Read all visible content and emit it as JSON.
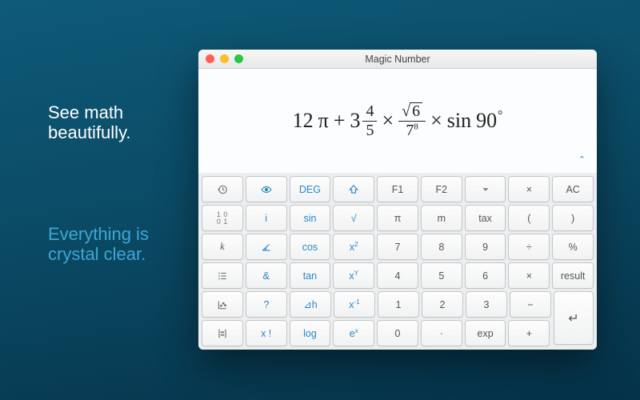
{
  "marketing": {
    "line1": "See math\nbeautifully.",
    "line2": "Everything is\ncrystal clear."
  },
  "window": {
    "title": "Magic Number"
  },
  "expression": {
    "coef": "12",
    "pi": "π",
    "plus": "+",
    "mixed_int": "3",
    "mixed_num": "4",
    "mixed_den": "5",
    "times": "×",
    "sqrt_arg": "6",
    "big_frac_base": "7",
    "big_frac_exp": "8",
    "sin": "sin",
    "angle": "90",
    "deg": "°"
  },
  "keys": {
    "r1": [
      "history-icon",
      "eye-icon",
      "DEG",
      "shift-icon",
      "F1",
      "F2",
      "dropdown-icon",
      "close-x",
      "AC"
    ],
    "r2": [
      "binary-icon",
      "i",
      "sin",
      "√",
      "π",
      "m",
      "tax",
      "(",
      ")"
    ],
    "r3": [
      "k",
      "angle-icon",
      "cos",
      "x²",
      "7",
      "8",
      "9",
      "÷",
      "%"
    ],
    "r4": [
      "list-icon",
      "&",
      "tan",
      "xʸ",
      "4",
      "5",
      "6",
      "×",
      "result"
    ],
    "r5": [
      "plot-icon",
      "?",
      "⊿h",
      "x⁻¹",
      "1",
      "2",
      "3",
      "−",
      "enter-icon"
    ],
    "r6": [
      "matrix-icon",
      "x !",
      "log",
      "eˣ",
      "0",
      ".",
      "exp",
      "+",
      "enter-span"
    ]
  },
  "blue_keys": [
    "eye-icon",
    "DEG",
    "shift-icon",
    "i",
    "sin",
    "angle-icon",
    "cos",
    "x²",
    "&",
    "tan",
    "xʸ",
    "?",
    "⊿h",
    "x⁻¹",
    "x !",
    "log",
    "eˣ",
    "√"
  ],
  "labels": {
    "DEG": "DEG",
    "F1": "F1",
    "F2": "F2",
    "AC": "AC",
    "i": "i",
    "sin": "sin",
    "√": "√",
    "π": "π",
    "m": "m",
    "tax": "tax",
    "(": "(",
    ")": ")",
    "k": "k",
    "cos": "cos",
    "7": "7",
    "8": "8",
    "9": "9",
    "÷": "÷",
    "%": "%",
    "&": "&",
    "tan": "tan",
    "4": "4",
    "5": "5",
    "6": "6",
    "×": "×",
    "result": "result",
    "?": "?",
    "⊿h": "⊿h",
    "1": "1",
    "2": "2",
    "3": "3",
    "−": "−",
    "x !": "x !",
    "log": "log",
    "0": "0",
    ".": "·",
    "exp": "exp",
    "+": "+",
    "close-x": "×"
  }
}
